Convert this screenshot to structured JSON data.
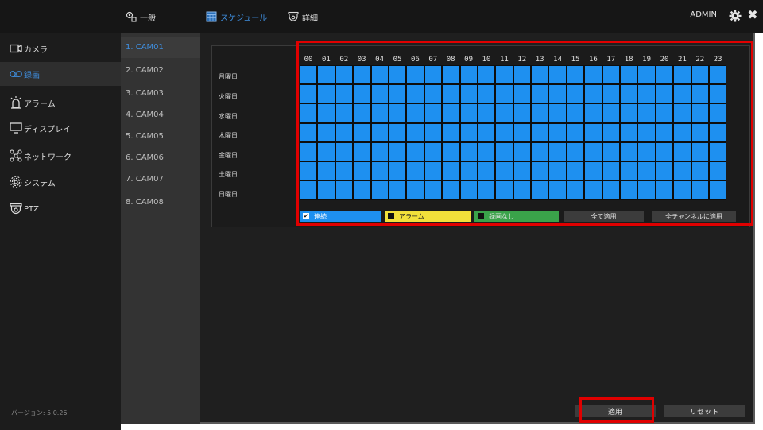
{
  "header": {
    "tabs": [
      {
        "label": "一般",
        "icon": "camera-settings-icon"
      },
      {
        "label": "スケジュール",
        "icon": "calendar-icon"
      },
      {
        "label": "詳細",
        "icon": "detail-camera-icon"
      }
    ],
    "active_tab": "スケジュール",
    "user": "ADMIN",
    "gear_icon": "gear-icon",
    "close_icon": "close-icon"
  },
  "sidebar": {
    "items": [
      {
        "label": "カメラ",
        "icon": "camera-icon"
      },
      {
        "label": "録画",
        "icon": "record-icon"
      },
      {
        "label": "アラーム",
        "icon": "alarm-icon"
      },
      {
        "label": "ディスプレイ",
        "icon": "display-icon"
      },
      {
        "label": "ネットワーク",
        "icon": "network-icon"
      },
      {
        "label": "システム",
        "icon": "system-gear-icon"
      },
      {
        "label": "PTZ",
        "icon": "ptz-camera-icon"
      }
    ],
    "active": "録画",
    "version": "バージョン: 5.0.26"
  },
  "cameras": {
    "items": [
      "1. CAM01",
      "2. CAM02",
      "3. CAM03",
      "4. CAM04",
      "5. CAM05",
      "6. CAM06",
      "7. CAM07",
      "8. CAM08"
    ],
    "active": "1. CAM01"
  },
  "schedule": {
    "hours": [
      "00",
      "01",
      "02",
      "03",
      "04",
      "05",
      "06",
      "07",
      "08",
      "09",
      "10",
      "11",
      "12",
      "13",
      "14",
      "15",
      "16",
      "17",
      "18",
      "19",
      "20",
      "21",
      "22",
      "23"
    ],
    "days": [
      "月曜日",
      "火曜日",
      "水曜日",
      "木曜日",
      "金曜日",
      "土曜日",
      "日曜日"
    ],
    "fill_mode": "連続",
    "legend": {
      "continuous": "連続",
      "alarm": "アラーム",
      "none": "録画なし"
    },
    "colors": {
      "continuous": "#1e90f0",
      "alarm": "#f2e03a",
      "none": "#3aa34a"
    },
    "apply_all_label": "全て適用",
    "apply_all_channels_label": "全チャンネルに適用"
  },
  "footer": {
    "apply_label": "適用",
    "reset_label": "リセット"
  }
}
